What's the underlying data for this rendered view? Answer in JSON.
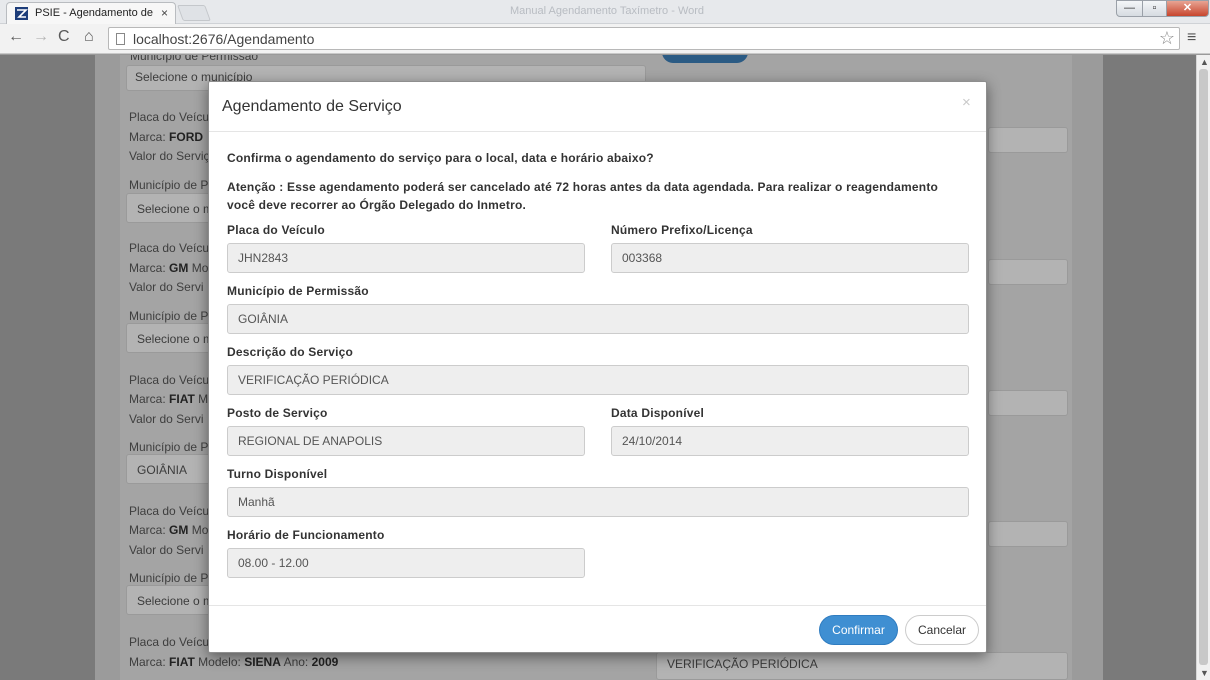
{
  "browser": {
    "tab_title": "PSIE - Agendamento de S",
    "tab_close": "×",
    "window_title": "Manual Agendamento Taxímetro - Word",
    "min": "—",
    "max": "▫",
    "close": "✕",
    "url": "localhost:2676/Agendamento",
    "back": "←",
    "forward": "→",
    "reload": "C",
    "home": "⌂",
    "star": "☆",
    "menu": "≡"
  },
  "background": {
    "top_select_label": "Município de Permissão",
    "top_select_value": "Selecione o município",
    "records": [
      {
        "placa": "Placa do Veículo",
        "marca_label": "Marca:",
        "marca": "FORD",
        "valor": "Valor do Serviço",
        "municipio": "Município de P",
        "select": "Selecione o m"
      },
      {
        "placa": "Placa do Veículo",
        "marca_label": "Marca:",
        "marca": "GM",
        "modelo": "Mo",
        "valor": "Valor do Servi",
        "municipio": "Município de P",
        "select": "Selecione o m"
      },
      {
        "placa": "Placa do Veículo",
        "marca_label": "Marca:",
        "marca": "FIAT",
        "modelo": "M",
        "valor": "Valor do Servi",
        "municipio": "Município de P",
        "select": "GOIÂNIA"
      },
      {
        "placa": "Placa do Veículo",
        "marca_label": "Marca:",
        "marca": "GM",
        "modelo": "Mo",
        "valor": "Valor do Servi",
        "municipio": "Município de P",
        "select": "Selecione o m"
      }
    ],
    "last_record": {
      "placa": "Placa do Veículo",
      "marca_line_prefix": "Marca:",
      "marca": "FIAT",
      "modelo_label": "Modelo:",
      "modelo": "SIENA",
      "ano_label": "Ano:",
      "ano": "2009"
    },
    "right_box_text": "VERIFICAÇÃO PERIÓDICA"
  },
  "modal": {
    "title": "Agendamento de Serviço",
    "close": "×",
    "question": "Confirma o agendamento do serviço para o local, data e horário abaixo?",
    "warning": "Atenção : Esse agendamento poderá ser cancelado até 72 horas antes da data agendada. Para realizar o reagendamento você deve recorrer ao Órgão Delegado do Inmetro.",
    "fields": {
      "placa_label": "Placa do Veículo",
      "placa_value": "JHN2843",
      "prefixo_label": "Número Prefixo/Licença",
      "prefixo_value": "003368",
      "municipio_label": "Município de Permissão",
      "municipio_value": "GOIÂNIA",
      "descricao_label": "Descrição do Serviço",
      "descricao_value": "VERIFICAÇÃO PERIÓDICA",
      "posto_label": "Posto de Serviço",
      "posto_value": "REGIONAL DE ANAPOLIS",
      "data_label": "Data Disponível",
      "data_value": "24/10/2014",
      "turno_label": "Turno Disponível",
      "turno_value": "Manhã",
      "horario_label": "Horário de Funcionamento",
      "horario_value": "08.00 - 12.00"
    },
    "confirm_label": "Confirmar",
    "cancel_label": "Cancelar"
  }
}
